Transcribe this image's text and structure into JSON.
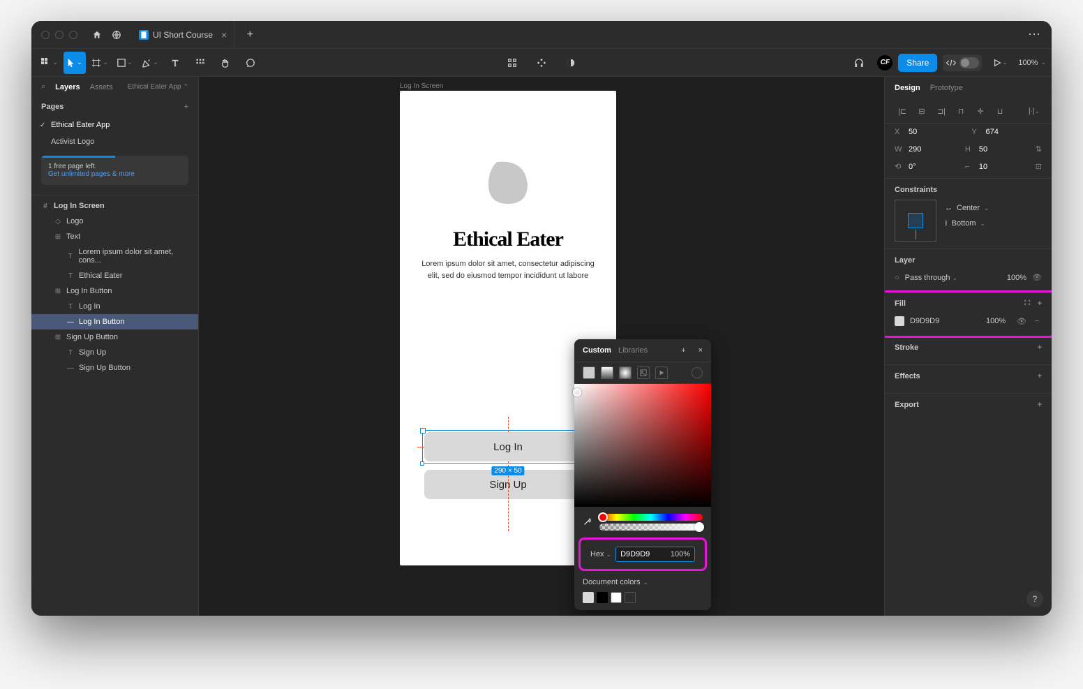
{
  "titlebar": {
    "tab_name": "UI Short Course"
  },
  "toolbar": {
    "share": "Share",
    "zoom": "100%"
  },
  "sidebar_left": {
    "tabs": {
      "layers": "Layers",
      "assets": "Assets"
    },
    "breadcrumb": "Ethical Eater App",
    "pages_title": "Pages",
    "pages": [
      "Ethical Eater App",
      "Activist Logo"
    ],
    "promo": {
      "text": "1 free page left.",
      "link": "Get unlimited pages & more"
    },
    "layers": [
      {
        "name": "Log In Screen",
        "type": "frame",
        "indent": 0
      },
      {
        "name": "Logo",
        "type": "component",
        "indent": 1
      },
      {
        "name": "Text",
        "type": "group",
        "indent": 1
      },
      {
        "name": "Lorem ipsum dolor sit amet, cons...",
        "type": "text",
        "indent": 2
      },
      {
        "name": "Ethical Eater",
        "type": "text",
        "indent": 2
      },
      {
        "name": "Log In Button",
        "type": "group",
        "indent": 1
      },
      {
        "name": "Log In",
        "type": "text",
        "indent": 2
      },
      {
        "name": "Log In Button",
        "type": "rect",
        "indent": 2,
        "selected": true
      },
      {
        "name": "Sign Up Button",
        "type": "group",
        "indent": 1
      },
      {
        "name": "Sign Up",
        "type": "text",
        "indent": 2
      },
      {
        "name": "Sign Up Button",
        "type": "rect",
        "indent": 2
      }
    ]
  },
  "canvas": {
    "frame_label": "Log In Screen",
    "app_title": "Ethical Eater",
    "app_desc": "Lorem ipsum dolor sit amet, consectetur adipiscing elit, sed do eiusmod tempor incididunt ut labore",
    "login_btn": "Log In",
    "signup_btn": "Sign Up",
    "dimensions": "290 × 50"
  },
  "colorpicker": {
    "tabs": {
      "custom": "Custom",
      "libraries": "Libraries"
    },
    "hex_label": "Hex",
    "hex_value": "D9D9D9",
    "hex_opacity": "100%",
    "doc_colors_title": "Document colors",
    "swatches": [
      "#d9d9d9",
      "#000000",
      "#ffffff",
      "#2c2c2c"
    ]
  },
  "sidebar_right": {
    "tabs": {
      "design": "Design",
      "prototype": "Prototype"
    },
    "x": {
      "label": "X",
      "value": "50"
    },
    "y": {
      "label": "Y",
      "value": "674"
    },
    "w": {
      "label": "W",
      "value": "290"
    },
    "h": {
      "label": "H",
      "value": "50"
    },
    "rotation": {
      "label": "⟐",
      "value": "0°"
    },
    "radius": {
      "label": "⌐",
      "value": "10"
    },
    "constraints": {
      "title": "Constraints",
      "h": "Center",
      "v": "Bottom"
    },
    "layer": {
      "title": "Layer",
      "blend": "Pass through",
      "opacity": "100%"
    },
    "fill": {
      "title": "Fill",
      "hex": "D9D9D9",
      "opacity": "100%"
    },
    "stroke": {
      "title": "Stroke"
    },
    "effects": {
      "title": "Effects"
    },
    "export": {
      "title": "Export"
    }
  }
}
